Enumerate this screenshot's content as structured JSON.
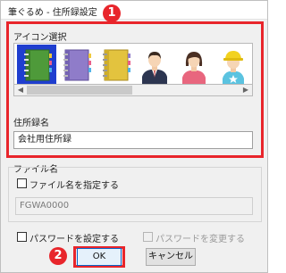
{
  "dialog": {
    "title": "筆ぐるめ - 住所録設定"
  },
  "callouts": {
    "first": "1",
    "second": "2"
  },
  "icon_select": {
    "label": "アイコン選択",
    "icons": [
      {
        "name": "green-notebook-icon",
        "selected": true
      },
      {
        "name": "purple-notebook-icon",
        "selected": false
      },
      {
        "name": "yellow-notebook-icon",
        "selected": false
      },
      {
        "name": "businessman-icon",
        "selected": false
      },
      {
        "name": "woman-icon",
        "selected": false
      },
      {
        "name": "child-icon",
        "selected": false
      }
    ]
  },
  "address_book_name": {
    "label": "住所録名",
    "value": "会社用住所録"
  },
  "file_name": {
    "label": "ファイル名",
    "specify_checkbox_label": "ファイル名を指定する",
    "specify_checked": false,
    "value": "FGWA0000"
  },
  "password": {
    "set_label": "パスワードを設定する",
    "set_checked": false,
    "change_label": "パスワードを変更する",
    "change_checked": false
  },
  "buttons": {
    "ok": "OK",
    "cancel": "キャンセル"
  },
  "colors": {
    "callout": "#e8252b",
    "selected_icon_bg": "#1f3ecf"
  }
}
